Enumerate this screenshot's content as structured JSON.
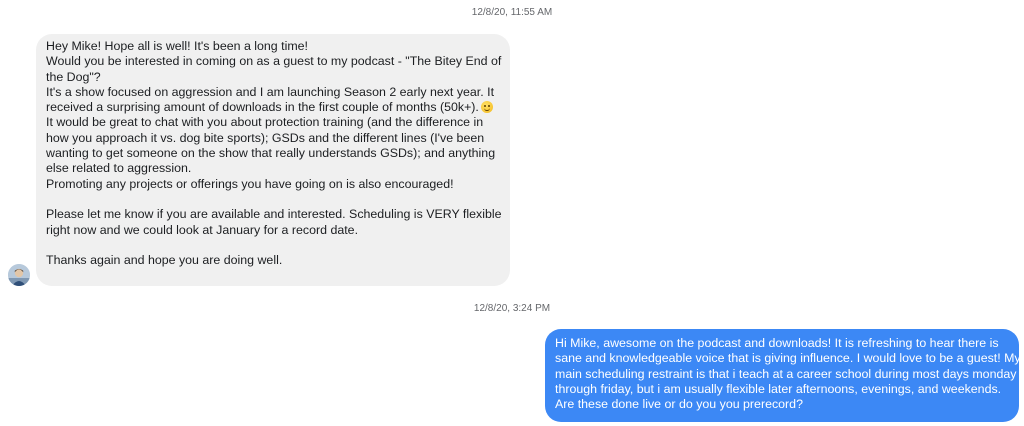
{
  "conversation": {
    "timestamps": [
      "12/8/20, 11:55 AM",
      "12/8/20, 3:24 PM"
    ],
    "incoming_message": {
      "lines": [
        "Hey Mike! Hope all is well! It's been a long time!",
        "Would you be interested in coming on as a guest to my podcast - \"The Bitey End of",
        "the Dog\"?",
        "It's a show focused on aggression and I am launching Season 2 early next year. It",
        "received a surprising amount of downloads in the first couple of months (50k+).",
        "It would be great to chat with you about protection training (and the difference in",
        "how you approach it vs. dog bite sports); GSDs and the different lines (I've been",
        "wanting to get someone on the show that really understands GSDs); and anything",
        "else related to aggression.",
        "Promoting any projects or offerings you have going on is also encouraged!",
        "",
        "Please let me know if you are available and interested. Scheduling is VERY flexible",
        "right now and we could look at January for a record date.",
        "",
        "Thanks again and hope you are doing well."
      ],
      "emoji": "smiling-face-emoji"
    },
    "outgoing_message": {
      "lines": [
        "Hi Mike, awesome on the podcast and downloads! It is refreshing to hear there is",
        "sane and knowledgeable voice that is giving influence. I would love to be a guest! My",
        "main scheduling restraint is that i teach at a career school during most days monday",
        "through friday, but i am usually flexible later afternoons, evenings, and weekends.",
        "Are these done live or do you you prerecord?"
      ]
    },
    "colors": {
      "incoming_bubble": "#f0f0f0",
      "outgoing_bubble": "#3c88f5",
      "timestamp_text": "#65676b"
    }
  }
}
